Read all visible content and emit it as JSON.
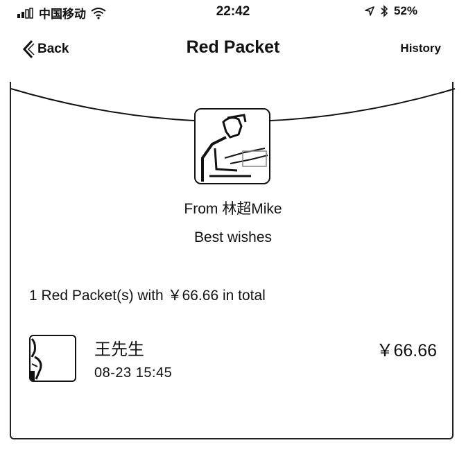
{
  "status_bar": {
    "carrier": "中国移动",
    "time": "22:42",
    "battery": "52%",
    "icons": [
      "signal-bars-icon",
      "wifi-icon",
      "location-icon",
      "bluetooth-icon",
      "battery-icon"
    ]
  },
  "nav": {
    "back_label": "Back",
    "title": "Red Packet",
    "history_label": "History"
  },
  "packet": {
    "from_label": "From 林超Mike",
    "wishes": "Best wishes",
    "summary": "1 Red Packet(s) with ￥66.66 in total"
  },
  "receivers": [
    {
      "name": "王先生",
      "time": "08-23 15:45",
      "amount": "￥66.66"
    }
  ],
  "colors": {
    "foreground": "#111111",
    "background": "#ffffff"
  }
}
